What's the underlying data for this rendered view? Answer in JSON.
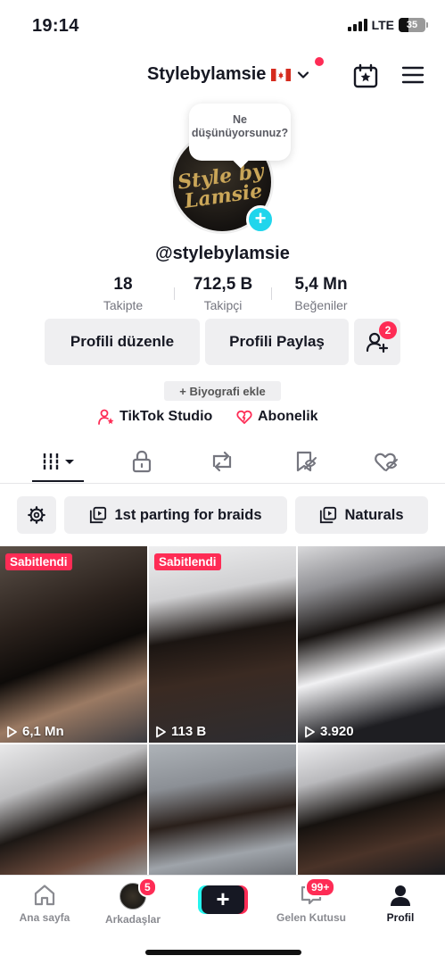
{
  "status_bar": {
    "time": "19:14",
    "network": "LTE",
    "battery": "35"
  },
  "header": {
    "username": "Stylebylamsie",
    "flag": "🇨🇦"
  },
  "profile": {
    "bubble_text": "Ne düşünüyorsunuz?",
    "avatar_text": "Style by Lamsie",
    "handle": "@stylebylamsie",
    "stats": [
      {
        "value": "18",
        "label": "Takipte"
      },
      {
        "value": "712,5 B",
        "label": "Takipçi"
      },
      {
        "value": "5,4 Mn",
        "label": "Beğeniler"
      }
    ],
    "buttons": {
      "edit": "Profili düzenle",
      "share": "Profili Paylaş",
      "friend_requests_count": "2"
    },
    "bio_button": "+ Biyografi ekle",
    "links": {
      "studio": "TikTok Studio",
      "subscription": "Abonelik"
    }
  },
  "tabs": [
    "videos-icon",
    "lock-icon",
    "repost-icon",
    "favorites-icon",
    "liked-icon"
  ],
  "filters": {
    "settings": "gear-icon",
    "playlist1": "1st parting for braids",
    "playlist2": "Naturals"
  },
  "videos": [
    {
      "pinned": "Sabitlendi",
      "views": "6,1 Mn"
    },
    {
      "pinned": "Sabitlendi",
      "views": "113 B"
    },
    {
      "pinned": "",
      "views": "3.920"
    },
    {
      "pinned": "",
      "views": ""
    },
    {
      "pinned": "",
      "views": ""
    },
    {
      "pinned": "",
      "views": ""
    }
  ],
  "bottom_nav": {
    "home": "Ana sayfa",
    "friends": "Arkadaşlar",
    "friends_badge": "5",
    "inbox": "Gelen Kutusu",
    "inbox_badge": "99+",
    "profile": "Profil"
  },
  "colors": {
    "accent": "#fe2c55",
    "cyan": "#20d5ec",
    "text": "#161823"
  }
}
